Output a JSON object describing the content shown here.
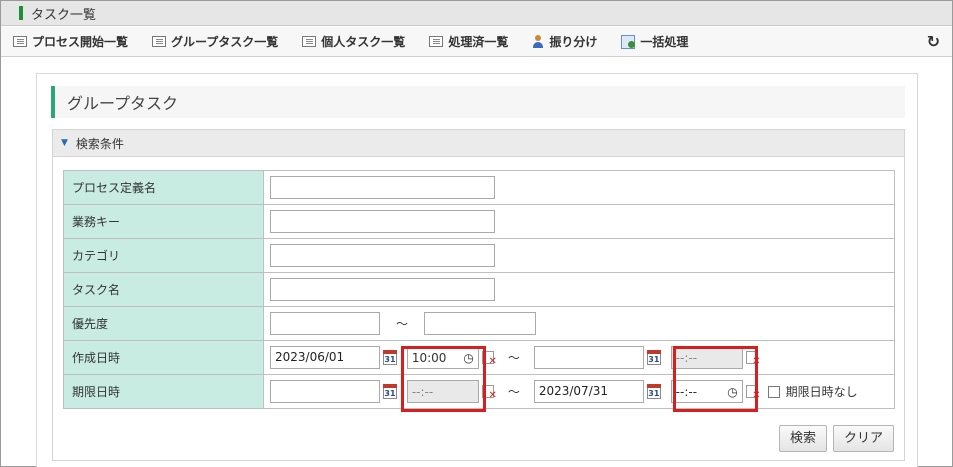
{
  "window": {
    "title": "タスク一覧"
  },
  "toolbar": {
    "items": [
      {
        "label": "プロセス開始一覧",
        "icon": "list-icon"
      },
      {
        "label": "グループタスク一覧",
        "icon": "list-icon"
      },
      {
        "label": "個人タスク一覧",
        "icon": "list-icon"
      },
      {
        "label": "処理済一覧",
        "icon": "list-icon"
      },
      {
        "label": "振り分け",
        "icon": "person-icon"
      },
      {
        "label": "一括処理",
        "icon": "batch-icon"
      }
    ],
    "refresh_icon": "refresh-icon"
  },
  "page": {
    "title": "グループタスク"
  },
  "search": {
    "section_label": "検索条件",
    "rows": {
      "process_def": {
        "label": "プロセス定義名",
        "value": ""
      },
      "business_key": {
        "label": "業務キー",
        "value": ""
      },
      "category": {
        "label": "カテゴリ",
        "value": ""
      },
      "task_name": {
        "label": "タスク名",
        "value": ""
      },
      "priority": {
        "label": "優先度",
        "from": "",
        "to": ""
      },
      "created": {
        "label": "作成日時",
        "from_date": "2023/06/01",
        "from_time": "10:00",
        "to_date": "",
        "to_time": "--:--"
      },
      "due": {
        "label": "期限日時",
        "from_date": "",
        "from_time": "--:--",
        "to_date": "2023/07/31",
        "to_time": "--:--",
        "no_due_label": "期限日時なし"
      }
    },
    "tilde": "～",
    "calendar_day": "31",
    "clock_glyph": "◷",
    "search_button": "検索",
    "clear_button": "クリア"
  },
  "colors": {
    "label_bg": "#c8ece2",
    "accent": "#2aa876",
    "highlight": "#d61f1f"
  }
}
